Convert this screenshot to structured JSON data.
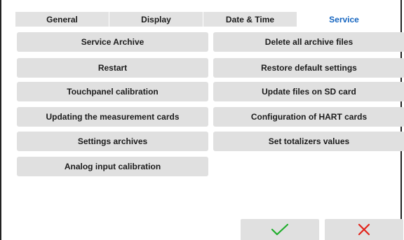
{
  "tabs": [
    {
      "label": "General"
    },
    {
      "label": "Display"
    },
    {
      "label": "Date & Time"
    },
    {
      "label": "Service"
    }
  ],
  "active_tab": "Service",
  "buttons": {
    "left": [
      {
        "label": "Service Archive"
      },
      {
        "label": "Restart"
      },
      {
        "label": "Touchpanel calibration"
      },
      {
        "label": "Updating the measurement cards"
      },
      {
        "label": "Settings archives"
      },
      {
        "label": "Analog input calibration"
      }
    ],
    "right": [
      {
        "label": "Delete all archive files"
      },
      {
        "label": "Restore default settings"
      },
      {
        "label": "Update files on SD card"
      },
      {
        "label": "Configuration of HART cards"
      },
      {
        "label": "Set totalizers values"
      }
    ]
  },
  "actions": {
    "ok_icon": "checkmark-icon",
    "cancel_icon": "cross-icon",
    "ok_color": "#1fae2b",
    "cancel_color": "#e2231a"
  },
  "colors": {
    "active_tab_text": "#1565c0",
    "button_bg": "#e0e0e0",
    "tab_bg": "#e2e2e2"
  }
}
